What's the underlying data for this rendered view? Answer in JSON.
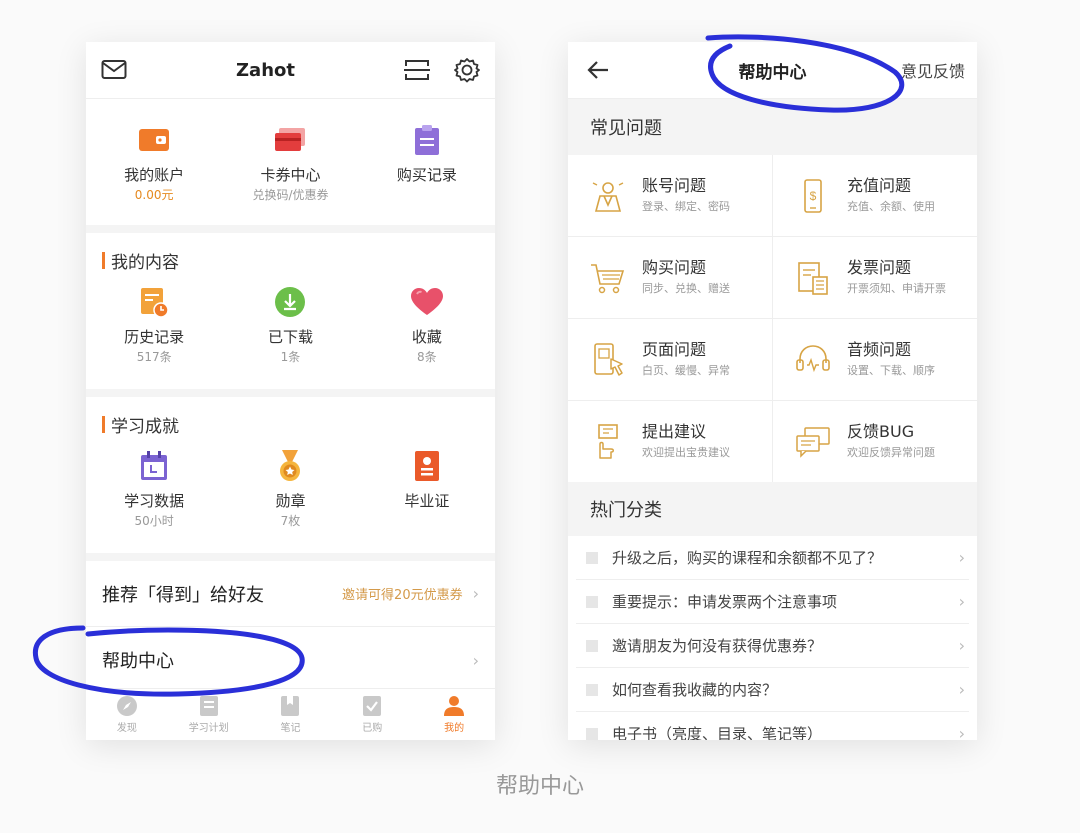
{
  "left": {
    "header": {
      "title": "Zahot"
    },
    "account": [
      {
        "label": "我的账户",
        "sub": "0.00元",
        "icon": "wallet-icon"
      },
      {
        "label": "卡券中心",
        "sub": "兑换码/优惠券",
        "icon": "card-icon"
      },
      {
        "label": "购买记录",
        "sub": "",
        "icon": "clipboard-icon"
      }
    ],
    "my_content": {
      "title": "我的内容",
      "items": [
        {
          "label": "历史记录",
          "sub": "517条",
          "icon": "history-icon"
        },
        {
          "label": "已下载",
          "sub": "1条",
          "icon": "download-icon"
        },
        {
          "label": "收藏",
          "sub": "8条",
          "icon": "heart-icon"
        }
      ]
    },
    "achievements": {
      "title": "学习成就",
      "items": [
        {
          "label": "学习数据",
          "sub": "50小时",
          "icon": "calendar-icon"
        },
        {
          "label": "勋章",
          "sub": "7枚",
          "icon": "medal-icon"
        },
        {
          "label": "毕业证",
          "sub": "",
          "icon": "certificate-icon"
        }
      ]
    },
    "recommend": {
      "label": "推荐「得到」给好友",
      "promo": "邀请可得20元优惠券"
    },
    "help": {
      "label": "帮助中心"
    },
    "tabs": [
      {
        "label": "发现",
        "icon": "compass-icon"
      },
      {
        "label": "学习计划",
        "icon": "plan-icon"
      },
      {
        "label": "笔记",
        "icon": "note-icon"
      },
      {
        "label": "已购",
        "icon": "purchased-icon"
      },
      {
        "label": "我的",
        "icon": "user-icon"
      }
    ]
  },
  "right": {
    "header": {
      "title": "帮助中心",
      "feedback": "意见反馈"
    },
    "faq_title": "常见问题",
    "faq": [
      {
        "title": "账号问题",
        "sub": "登录、绑定、密码",
        "icon": "account-icon"
      },
      {
        "title": "充值问题",
        "sub": "充值、余额、使用",
        "icon": "recharge-icon"
      },
      {
        "title": "购买问题",
        "sub": "同步、兑换、赠送",
        "icon": "cart-icon"
      },
      {
        "title": "发票问题",
        "sub": "开票须知、申请开票",
        "icon": "invoice-icon"
      },
      {
        "title": "页面问题",
        "sub": "白页、缓慢、异常",
        "icon": "page-icon"
      },
      {
        "title": "音频问题",
        "sub": "设置、下载、顺序",
        "icon": "headphones-icon"
      },
      {
        "title": "提出建议",
        "sub": "欢迎提出宝贵建议",
        "icon": "suggest-icon"
      },
      {
        "title": "反馈BUG",
        "sub": "欢迎反馈异常问题",
        "icon": "chat-icon"
      }
    ],
    "hot_title": "热门分类",
    "hot": [
      "升级之后，购买的课程和余额都不见了？",
      "重要提示：申请发票两个注意事项",
      "邀请朋友为何没有获得优惠券？",
      "如何查看我收藏的内容？",
      "电子书（亮度、目录、笔记等）"
    ]
  },
  "caption": "帮助中心",
  "colors": {
    "accent": "#f07b2a",
    "annotation": "#2a2fd8",
    "gold": "#d7a445"
  }
}
